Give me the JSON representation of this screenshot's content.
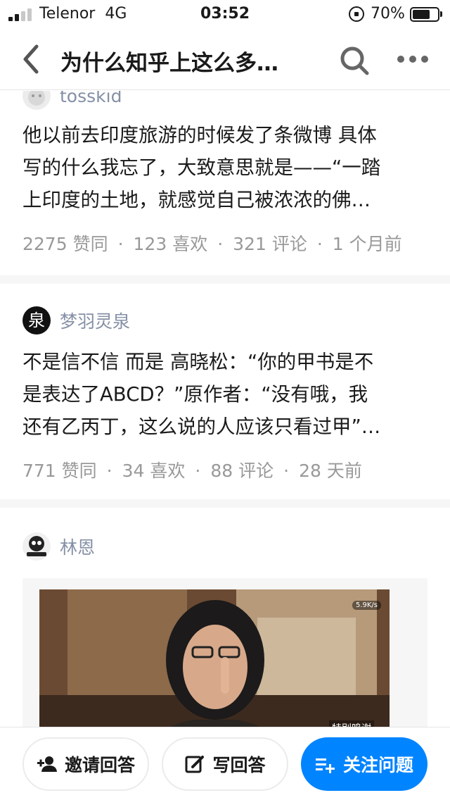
{
  "status_bar": {
    "carrier": "Telenor",
    "network": "4G",
    "time": "03:52",
    "battery_pct": "70%",
    "battery_level": 0.7,
    "signal_bars": 2
  },
  "nav": {
    "title": "为什么知乎上这么多…",
    "back_icon": "chevron-left-icon",
    "search_icon": "search-icon",
    "more_icon": "more-horizontal-icon"
  },
  "answers": [
    {
      "author": "tosskid",
      "excerpt_lines": [
        "他以前去印度旅游的时候发了条微博 具体",
        "写的什么我忘了，大致意思就是——“一踏",
        "上印度的土地，就感觉自己被浓浓的佛…"
      ],
      "upvotes": "2275 赞同",
      "likes": "123 喜欢",
      "comments": "321 评论",
      "time": "1 个月前"
    },
    {
      "author": "梦羽灵泉",
      "avatar_char": "泉",
      "excerpt_lines": [
        "不是信不信 而是 高晓松：“你的甲书是不",
        "是表达了ABCD？”原作者：“没有哦，我",
        "还有乙丙丁，这么说的人应该只看过甲”…"
      ],
      "upvotes": "771 赞同",
      "likes": "34 喜欢",
      "comments": "88 评论",
      "time": "28 天前"
    },
    {
      "author": "林恩",
      "video_watermark": "5.9K/s",
      "video_caption": "特别鸣谢"
    }
  ],
  "bottom_bar": {
    "invite_label": "邀请回答",
    "write_label": "写回答",
    "follow_label": "关注问题",
    "invite_icon": "add-person-icon",
    "write_icon": "edit-icon",
    "follow_icon": "add-list-icon"
  },
  "colors": {
    "primary": "#0084ff",
    "meta_text": "#999999",
    "author_text": "#8590a6",
    "separator": "#f6f6f6"
  }
}
